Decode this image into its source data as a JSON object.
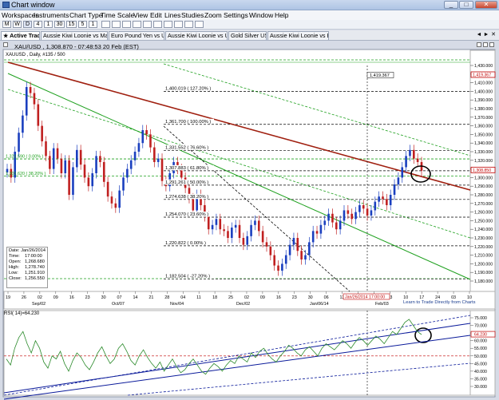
{
  "window": {
    "title": "Chart window",
    "controls": [
      "_",
      "□",
      "✕"
    ]
  },
  "menu": [
    "Workspaces",
    "Instruments",
    "Chart Type",
    "Time Scale",
    "View",
    "Edit",
    "Lines",
    "Studies",
    "Zoom",
    "Settings",
    "Window",
    "Help"
  ],
  "toolbar_buttons": [
    "M",
    "W",
    "D",
    "4",
    "1",
    "30",
    "15",
    "5",
    "1"
  ],
  "tabs": [
    {
      "label": "★ Active Trades",
      "active": true
    },
    {
      "label": "Aussie Kiwi Loonie vs Majors",
      "active": false
    },
    {
      "label": "Euro Pound Yen vs USD",
      "active": false
    },
    {
      "label": "Aussie Kiwi Loonie vs USD",
      "active": false
    },
    {
      "label": "Gold Silver USD",
      "active": false
    },
    {
      "label": "Aussie Kiwi Loonie vs Euro",
      "active": false
    }
  ],
  "chart_header": "XAU/USD , 1,308.870 - 07:48:53 20 Feb (EST)",
  "series_label": "XAUUSD , Daily, #135 / 500",
  "info_box": {
    "rows": [
      {
        "k": "Date:",
        "v": "Jan/26/2014"
      },
      {
        "k": "Time:",
        "v": "17:00:00"
      },
      {
        "k": "Open:",
        "v": "1,268.680"
      },
      {
        "k": "High:",
        "v": "1,278.740"
      },
      {
        "k": "Low:",
        "v": "1,251.910"
      },
      {
        "k": "Close:",
        "v": "1,256.550"
      }
    ]
  },
  "fib_levels": [
    {
      "label": "1,400.019 ( 127.20% )",
      "price": 1400.019
    },
    {
      "label": "1,361.700 ( 100.00% )",
      "price": 1361.7
    },
    {
      "label": "1,331.552 ( 76.60% )",
      "price": 1331.552
    },
    {
      "label": "1,307.883 ( 61.80% )",
      "price": 1307.883
    },
    {
      "label": "1,291.261 ( 50.00% )",
      "price": 1291.261
    },
    {
      "label": "1,274.638 ( 38.20% )",
      "price": 1274.638
    },
    {
      "label": "1,254.070 ( 23.60% )",
      "price": 1254.07
    },
    {
      "label": "1,220.822 ( 0.00% )",
      "price": 1220.822
    },
    {
      "label": "1,182.504 ( -27.20% )",
      "price": 1182.504
    }
  ],
  "green_levels": [
    {
      "label": "1,321.590 ( 0.00% )",
      "price": 1321.59
    },
    {
      "label": "1,301.620 ( 38.20% )",
      "price": 1301.62
    }
  ],
  "top_marker": {
    "label": "1,419.367",
    "price": 1419.367
  },
  "price_axis": {
    "ticks": [
      "1,430.000",
      "1,420.000",
      "1,410.000",
      "1,400.000",
      "1,390.000",
      "1,380.000",
      "1,370.000",
      "1,360.000",
      "1,350.000",
      "1,340.000",
      "1,330.000",
      "1,320.000",
      "1,310.000",
      "1,300.000",
      "1,290.000",
      "1,280.000",
      "1,270.000",
      "1,260.000",
      "1,250.000",
      "1,240.000",
      "1,230.000",
      "1,220.000",
      "1,210.000",
      "1,200.000",
      "1,190.000",
      "1,180.000"
    ],
    "highlights": [
      {
        "label": "1,419.367",
        "color": "#c00000"
      },
      {
        "label": "1,308.850",
        "color": "#c00000"
      }
    ]
  },
  "date_axis": {
    "top_row": [
      "19",
      "26",
      "02",
      "09",
      "16",
      "23",
      "30",
      "07",
      "14",
      "21",
      "28",
      "04",
      "11",
      "18",
      "25",
      "02",
      "09",
      "16",
      "23",
      "30",
      "06",
      "13",
      "20",
      "27",
      "03",
      "10",
      "17",
      "24",
      "03",
      "10"
    ],
    "bottom_row": [
      "Sep/02",
      "Oct/07",
      "Nov/04",
      "Dec/02",
      "Jan/06/14",
      "Feb/03"
    ],
    "cursor_label": "Jan/26/2014 17:00:00"
  },
  "footer_link": "Learn to Trade Directly from Charts",
  "rsi": {
    "title": "RSI( 14)=64.230",
    "ticks": [
      "75.000",
      "70.000",
      "65.000",
      "60.000",
      "55.000",
      "50.000",
      "45.000",
      "40.000",
      "35.000",
      "30.000"
    ],
    "current": "64.230",
    "midline": 50
  },
  "colors": {
    "up_candle": "#1a3fbf",
    "down_candle": "#c02020",
    "red_trendline": "#a02010",
    "green_line": "#1ea01e",
    "rsi_line": "#2a8a2a",
    "channel": "#0a1a9a"
  }
}
